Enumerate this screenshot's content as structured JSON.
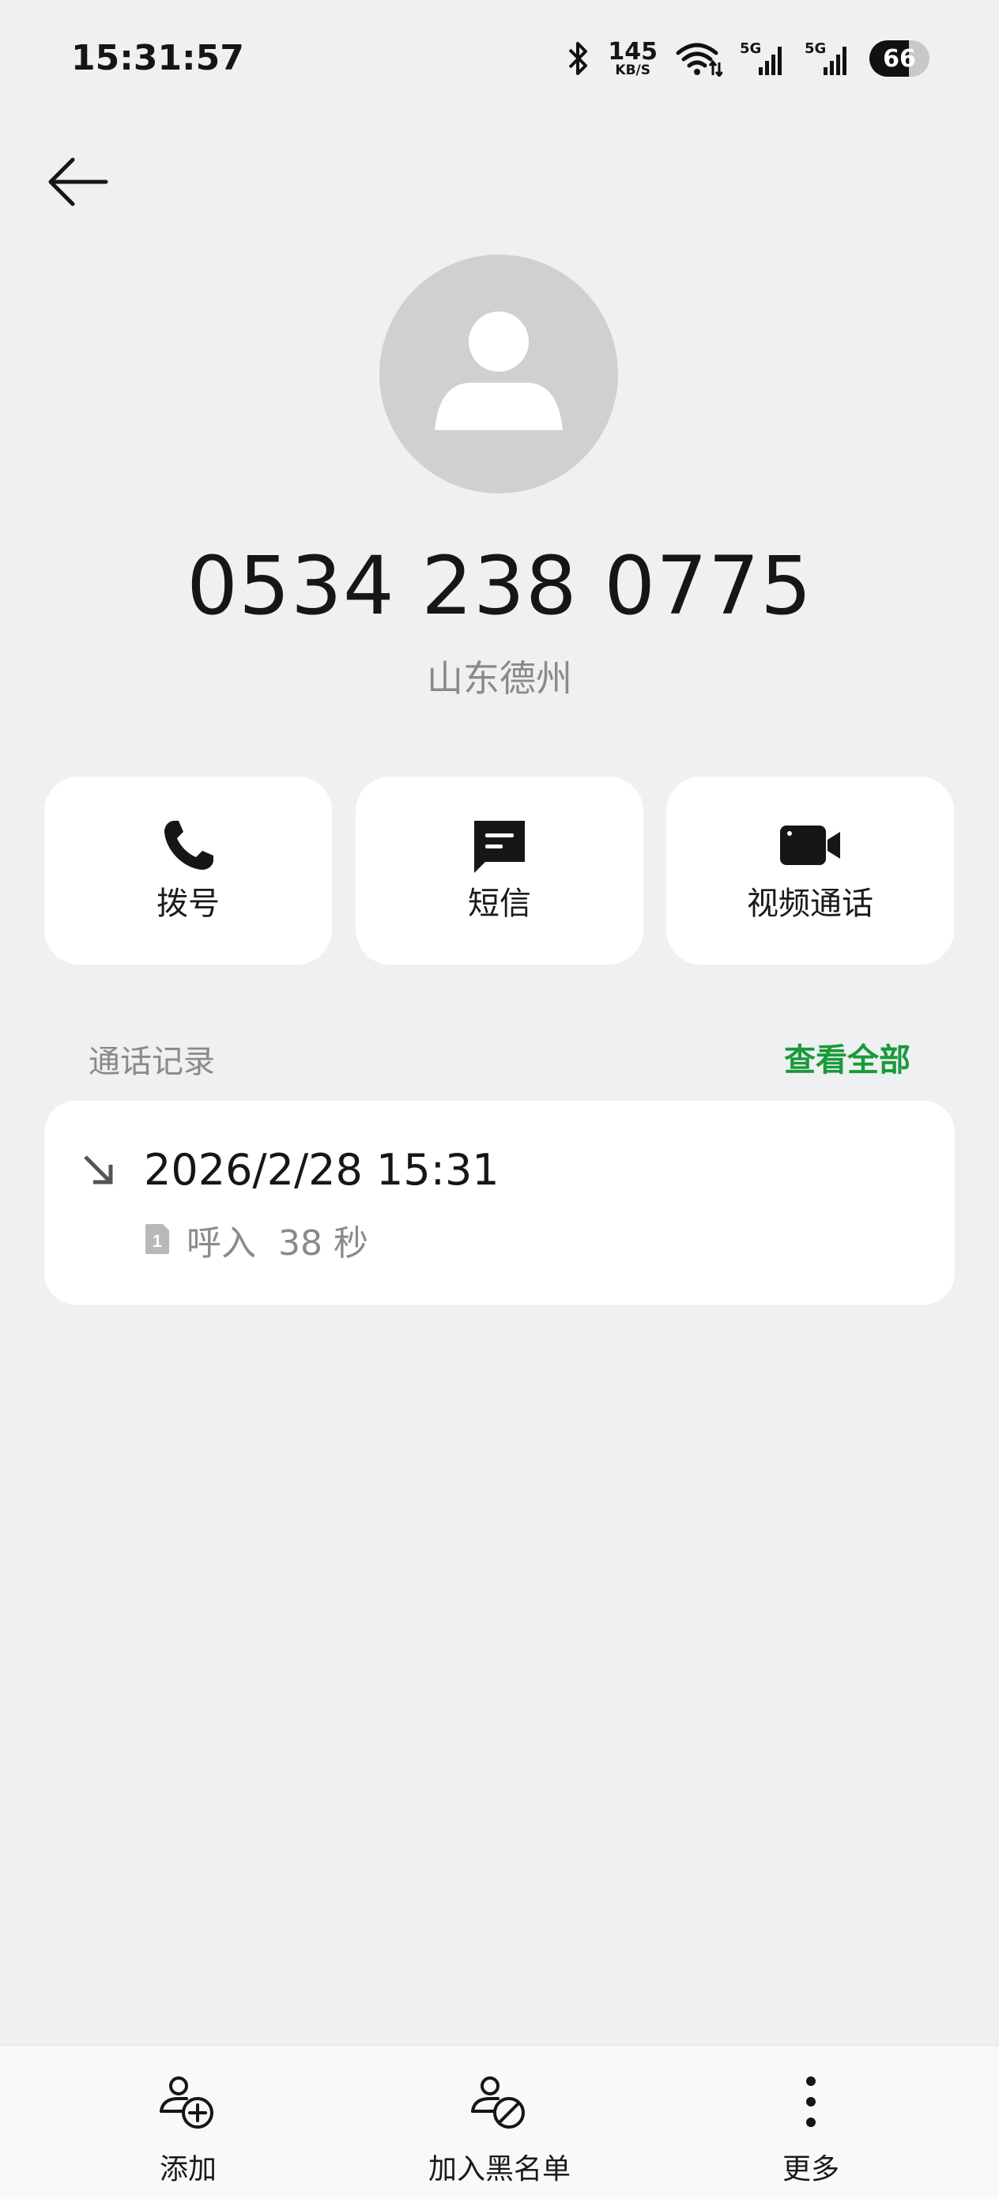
{
  "status_bar": {
    "time": "15:31:57",
    "net_speed_value": "145",
    "net_speed_unit": "KB/S",
    "sim1_label": "5G",
    "sim2_label": "5G",
    "battery": "66",
    "icons": [
      "bluetooth-icon",
      "wifi-icon",
      "signal-icon",
      "signal-icon",
      "battery-icon"
    ]
  },
  "header": {
    "back_icon": "arrow-left-icon"
  },
  "contact": {
    "avatar_icon": "person-icon",
    "number": "0534 238 0775",
    "location": "山东德州"
  },
  "actions": [
    {
      "label": "拨号",
      "icon": "phone-icon"
    },
    {
      "label": "短信",
      "icon": "message-icon"
    },
    {
      "label": "视频通话",
      "icon": "video-camera-icon"
    }
  ],
  "call_log": {
    "title": "通话记录",
    "see_all": "查看全部",
    "entries": [
      {
        "time": "2026/2/28 15:31",
        "sim": "1",
        "detail": "呼入  38 秒",
        "direction_icon": "incoming-arrow-icon"
      }
    ]
  },
  "bottom_bar": [
    {
      "label": "添加",
      "icon": "add-contact-icon"
    },
    {
      "label": "加入黑名单",
      "icon": "block-contact-icon"
    },
    {
      "label": "更多",
      "icon": "more-vertical-icon"
    }
  ],
  "colors": {
    "background": "#eff0f2",
    "card": "#ffffff",
    "accent_green": "#1a9a3a",
    "secondary_text": "#8a8a8a"
  }
}
